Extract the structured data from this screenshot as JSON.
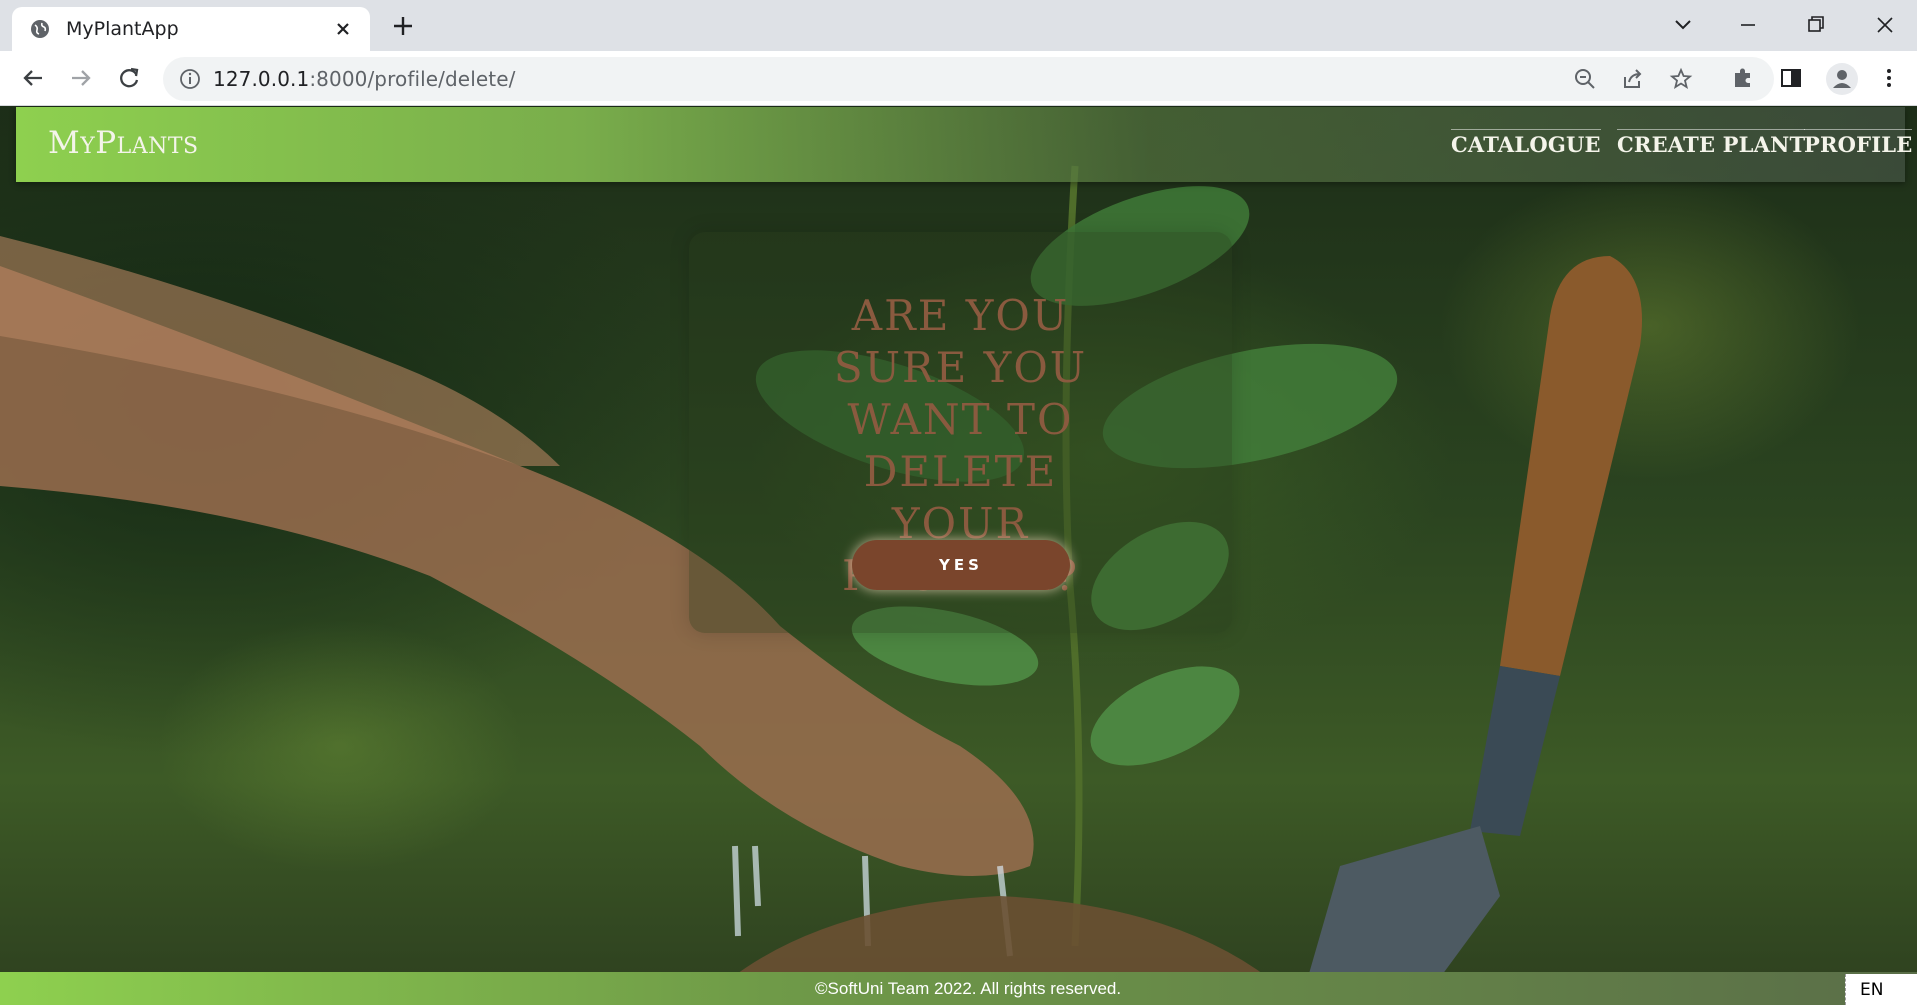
{
  "browser": {
    "tab_title": "MyPlantApp",
    "url_host": "127.0.0.1",
    "url_path": ":8000/profile/delete/"
  },
  "navbar": {
    "brand": "MyPlants",
    "links": [
      {
        "label": "CATALOGUE"
      },
      {
        "label": "CREATE PLANT"
      },
      {
        "label": "PROFILE"
      }
    ]
  },
  "dialog": {
    "title": "ARE YOU SURE YOU WANT TO DELETE YOUR PROFILE?",
    "confirm_label": "YES"
  },
  "footer": {
    "text": "©SoftUni Team 2022. All rights reserved.",
    "language": "EN"
  },
  "colors": {
    "accent_green": "#8ed04f",
    "button_brown": "#7a452c",
    "title_brown": "#8a5a3f"
  }
}
